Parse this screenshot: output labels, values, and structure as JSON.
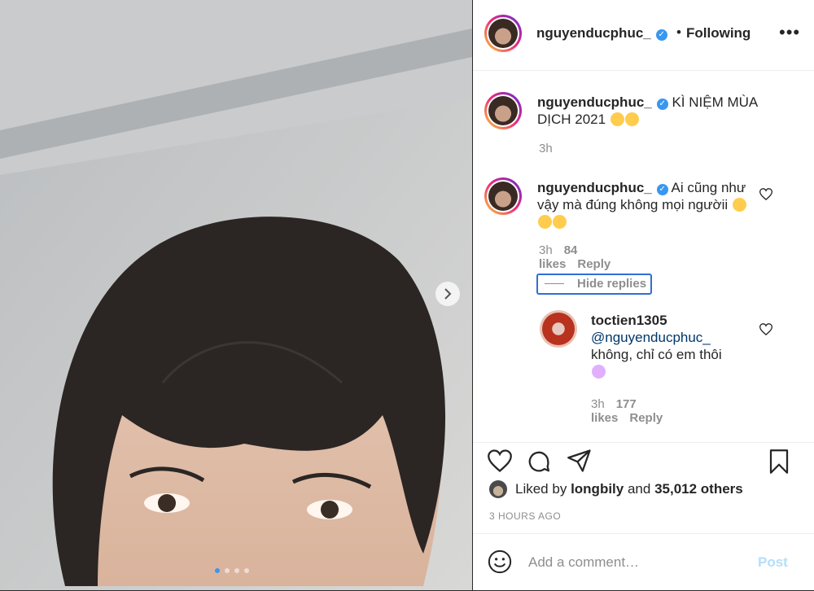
{
  "post": {
    "username": "nguyenducphuc_",
    "separator": "•",
    "follow_label": "Following",
    "more_icon": "more-options-icon",
    "caption": {
      "username": "nguyenducphuc_",
      "text": "KÌ NIỆM MÙA DỊCH 2021",
      "time": "3h"
    },
    "comment": {
      "username": "nguyenducphuc_",
      "text": "Ai cũng như vậy mà đúng không mọi ngườii",
      "time": "3h",
      "likes": "84 likes",
      "reply": "Reply"
    },
    "hide_replies": "Hide replies",
    "reply": {
      "username": "toctien1305",
      "mention": "@nguyenducphuc_",
      "text": "không, chỉ có em thôi",
      "time": "3h",
      "likes": "177 likes",
      "reply": "Reply"
    },
    "liked_by_prefix": "Liked by",
    "liked_by_user": "longbily",
    "liked_by_and": "and",
    "liked_by_others": "35,012 others",
    "time_ago": "3 HOURS AGO",
    "comment_placeholder": "Add a comment…",
    "post_label": "Post",
    "carousel": {
      "total": 4,
      "active": 1
    }
  },
  "colors": {
    "verified": "#3897f0",
    "link": "#00376b",
    "post_disabled": "#b2dffc",
    "muted": "#8e8e8e"
  }
}
